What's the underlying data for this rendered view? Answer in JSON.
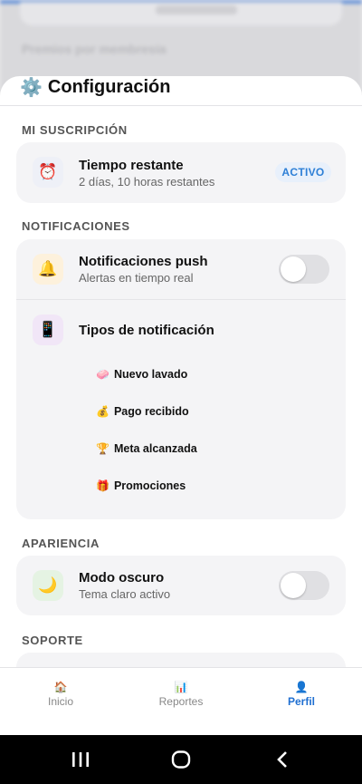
{
  "background": {
    "text": "Premios por membresía"
  },
  "header": {
    "title": "Configuración",
    "title_icon": "gear-icon"
  },
  "sections": {
    "subscription": {
      "label": "MI SUSCRIPCIÓN",
      "title": "Tiempo restante",
      "subtitle": "2 días, 10 horas restantes",
      "badge": "ACTIVO",
      "icon": "alarm-clock-icon"
    },
    "notifications": {
      "label": "NOTIFICACIONES",
      "push_title": "Notificaciones push",
      "push_subtitle": "Alertas en tiempo real",
      "push_enabled": false,
      "types_title": "Tipos de notificación",
      "types": [
        {
          "label": "Nuevo lavado",
          "icon": "🧼"
        },
        {
          "label": "Pago recibido",
          "icon": "💰"
        },
        {
          "label": "Meta alcanzada",
          "icon": "🏆"
        },
        {
          "label": "Promociones",
          "icon": "🎁"
        }
      ]
    },
    "appearance": {
      "label": "APARIENCIA",
      "title": "Modo oscuro",
      "subtitle": "Tema claro activo",
      "dark_enabled": false
    },
    "support": {
      "label": "SOPORTE"
    }
  },
  "tabbar": {
    "tabs": [
      {
        "label": "Inicio",
        "icon": "🏠",
        "active": false
      },
      {
        "label": "Reportes",
        "icon": "📊",
        "active": false
      },
      {
        "label": "Perfil",
        "icon": "👤",
        "active": true
      }
    ]
  },
  "colors": {
    "accent": "#1f6fd1",
    "badge_bg": "#e8f0fb",
    "card_bg": "#f4f4f6"
  }
}
